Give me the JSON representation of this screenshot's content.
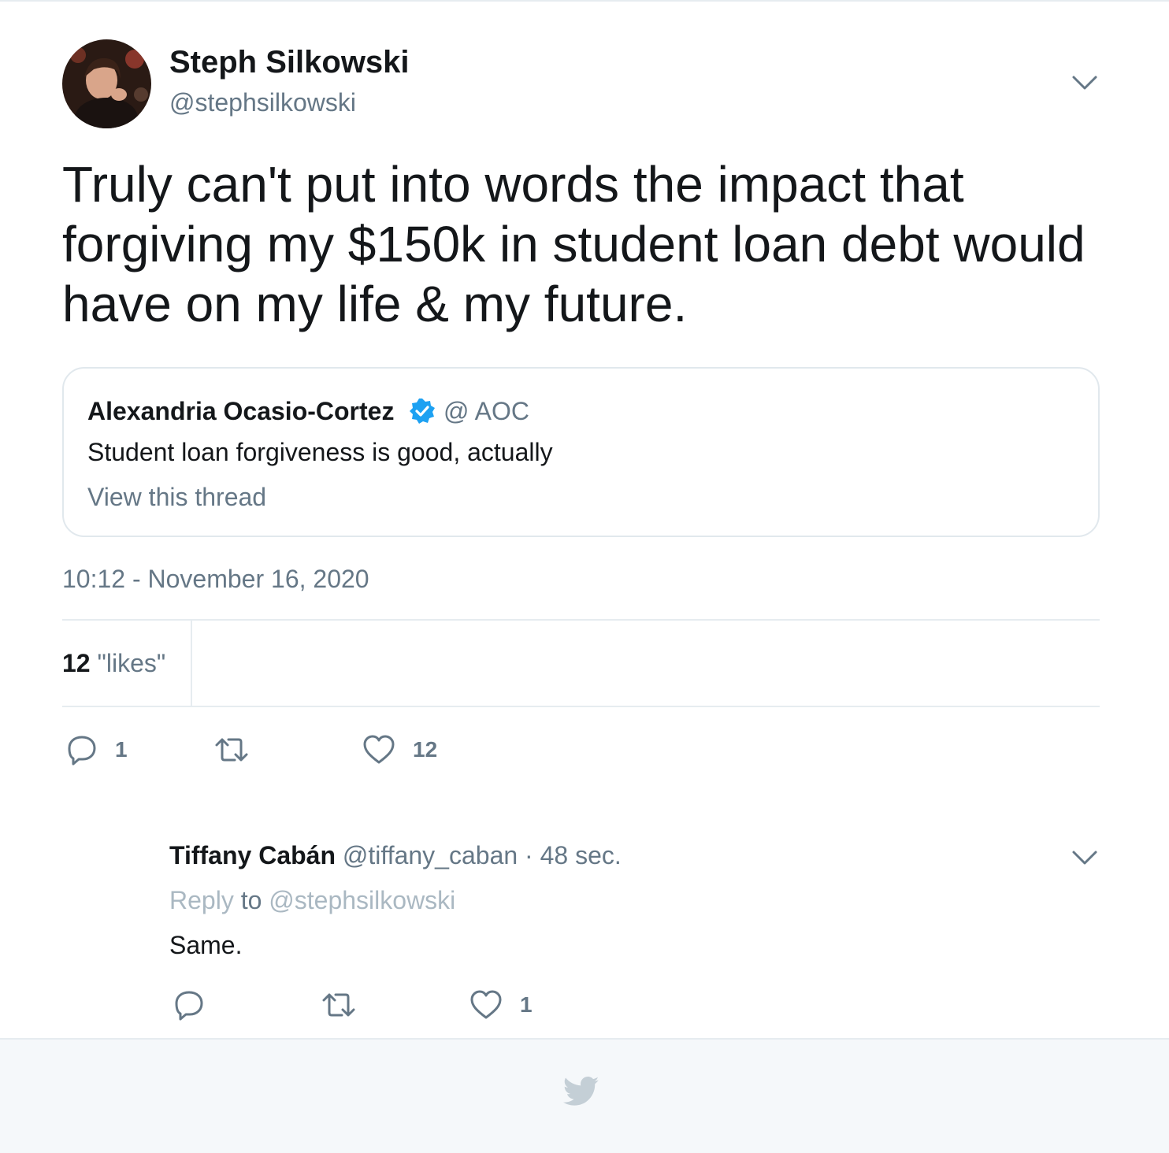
{
  "tweet": {
    "author_name": "Steph Silkowski",
    "author_handle": "@stephsilkowski",
    "text": "Truly can't put into words the impact that forgiving my $150k in student loan debt would have on my life & my future.",
    "timestamp": "10:12 - November 16, 2020",
    "likes_count": "12",
    "likes_label": "\"likes\"",
    "actions": {
      "reply_count": "1",
      "like_count": "12"
    }
  },
  "quote": {
    "author_name": "Alexandria Ocasio-Cortez",
    "author_handle": "@ AOC",
    "text": "Student loan forgiveness is good, actually",
    "link": "View this thread"
  },
  "reply": {
    "author_name": "Tiffany Cabán",
    "meta": " @tiffany_caban · 48 sec.",
    "replying_label": "Reply",
    "replying_to": " to ",
    "replying_handle": "@stephsilkowski",
    "text": "Same.",
    "like_count": "1"
  },
  "colors": {
    "text_primary": "#14171a",
    "text_secondary": "#657786",
    "border": "#e6ecf0",
    "verified": "#1da1f2",
    "footer_bg": "#f5f8fa"
  },
  "icons": [
    "avatar",
    "chevron-down-icon",
    "verified-badge-icon",
    "reply-icon",
    "retweet-icon",
    "like-icon",
    "twitter-bird-icon"
  ]
}
